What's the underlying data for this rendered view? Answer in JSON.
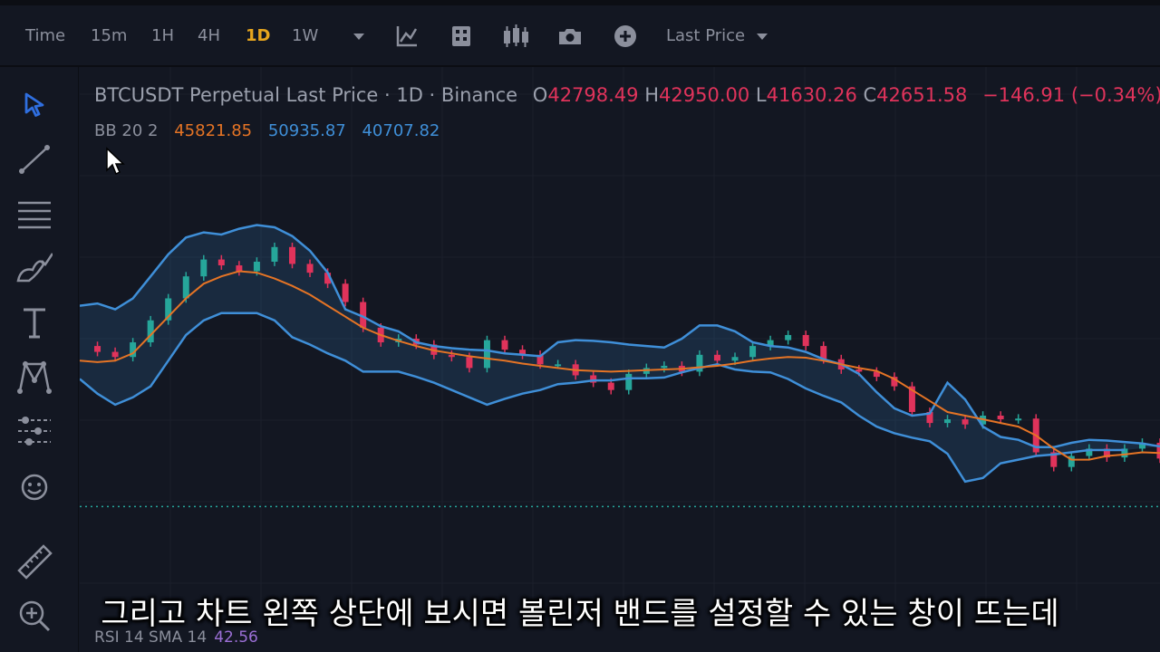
{
  "toolbar": {
    "intervals": [
      {
        "label": "Time",
        "active": false
      },
      {
        "label": "15m",
        "active": false
      },
      {
        "label": "1H",
        "active": false
      },
      {
        "label": "4H",
        "active": false
      },
      {
        "label": "1D",
        "active": true
      },
      {
        "label": "1W",
        "active": false
      }
    ],
    "interval_menu_icon": "caret-down-icon",
    "icons": [
      "indicators-icon",
      "layout-grid-icon",
      "candles-icon",
      "camera-icon",
      "plus-circle-icon"
    ],
    "price_type_label": "Last Price",
    "price_type_icon": "caret-down-icon"
  },
  "sidebar": {
    "tools": [
      "cursor-arrow-icon",
      "trend-line-icon",
      "horizontal-lines-icon",
      "brush-icon",
      "text-icon",
      "pattern-icon",
      "prediction-icon",
      "emoji-icon",
      "ruler-icon",
      "zoom-in-icon"
    ]
  },
  "legend": {
    "symbol_title": "BTCUSDT Perpetual Last Price · 1D · Binance",
    "open_label": "O",
    "open": "42798.49",
    "high_label": "H",
    "high": "42950.00",
    "low_label": "L",
    "low": "41630.26",
    "close_label": "C",
    "close": "42651.58",
    "change": "−146.91 (−0.34%)",
    "colors": {
      "text": "#9ba0ad",
      "down": "#e0335b",
      "up": "#26a69a"
    }
  },
  "indicator": {
    "label": "BB 20 2",
    "basis": "45821.85",
    "upper": "50935.87",
    "lower": "40707.82",
    "colors": {
      "basis": "#e57425",
      "bands": "#3f8fd8",
      "fill": "#1c3f5a"
    }
  },
  "rsi": {
    "label": "RSI 14 SMA 14",
    "value": "42.56"
  },
  "subtitle": "그리고 차트 왼쪽 상단에 보시면 볼린저 밴드를 설정할 수 있는 창이 뜨는데",
  "chart_data": {
    "type": "line",
    "series": [
      {
        "name": "Close",
        "values": [
          58000,
          57200,
          56500,
          58500,
          61500,
          64500,
          67500,
          69800,
          69000,
          68200,
          69500,
          71500,
          69200,
          68000,
          66500,
          64000,
          60500,
          58500,
          59000,
          58200,
          56800,
          56500,
          55000,
          58800,
          57500,
          56800,
          55500,
          55500,
          54000,
          53000,
          52000,
          54200,
          55000,
          55300,
          54500,
          56800,
          56000,
          56500,
          58000,
          58800,
          59500,
          58000,
          56200,
          54800,
          54500,
          53800,
          52500,
          49000,
          47500,
          48000,
          47300,
          48500,
          48000,
          48100,
          43500,
          41500,
          43000,
          44000,
          42800,
          44000,
          44800,
          42650
        ]
      },
      {
        "name": "BB 20 2 basis",
        "values": [
          56000,
          55800,
          56000,
          57000,
          59500,
          62000,
          64500,
          66500,
          67500,
          68200,
          68000,
          67200,
          66200,
          65000,
          63500,
          62000,
          60500,
          59500,
          58700,
          58000,
          57400,
          57000,
          56600,
          56300,
          56000,
          55600,
          55300,
          55000,
          54700,
          54600,
          54500,
          54600,
          54700,
          54800,
          54900,
          55100,
          55300,
          55600,
          56000,
          56300,
          56500,
          56400,
          56000,
          55500,
          55000,
          54600,
          53500,
          52000,
          50500,
          49000,
          48500,
          48000,
          47500,
          47000,
          45800,
          44000,
          42500,
          42500,
          43000,
          43200,
          43500,
          43400
        ]
      },
      {
        "name": "BB 20 2 upper",
        "values": [
          63500,
          63800,
          63000,
          64500,
          67500,
          70500,
          72800,
          73500,
          73200,
          74000,
          74500,
          74200,
          73000,
          71000,
          68000,
          63000,
          62000,
          60700,
          60000,
          58500,
          58000,
          57700,
          57500,
          57400,
          57000,
          56800,
          56600,
          58500,
          58800,
          58700,
          58500,
          58200,
          58000,
          57800,
          59000,
          60800,
          60800,
          60000,
          58500,
          58000,
          57800,
          57200,
          56200,
          55500,
          54200,
          51700,
          49500,
          48500,
          48800,
          53000,
          50700,
          47000,
          45600,
          45200,
          44200,
          44200,
          44800,
          45200,
          45100,
          44900,
          44700,
          44300
        ]
      },
      {
        "name": "BB 20 2 lower",
        "values": [
          53500,
          51500,
          50000,
          51000,
          52500,
          56000,
          59500,
          61500,
          62500,
          62500,
          62500,
          61500,
          59200,
          58200,
          57000,
          56000,
          54500,
          54500,
          54500,
          53800,
          53000,
          52000,
          51000,
          50000,
          50800,
          51500,
          52000,
          52800,
          53000,
          53300,
          53300,
          53600,
          53600,
          53700,
          54400,
          55000,
          55500,
          54800,
          54500,
          54400,
          53500,
          52200,
          51200,
          50300,
          48500,
          47000,
          46100,
          45500,
          45000,
          43300,
          39500,
          40000,
          42000,
          42500,
          43000,
          43200,
          43500,
          43800,
          43800,
          43800
        ]
      }
    ],
    "horizontal_line": {
      "value": 42650,
      "style": "dotted",
      "color": "#26a69a"
    },
    "colors": {
      "up": "#26a69a",
      "down": "#e0335b",
      "basis": "#e57425",
      "bands": "#3f8fd8",
      "background": "#131722"
    },
    "grid": true,
    "ylim": [
      38000,
      80000
    ]
  }
}
